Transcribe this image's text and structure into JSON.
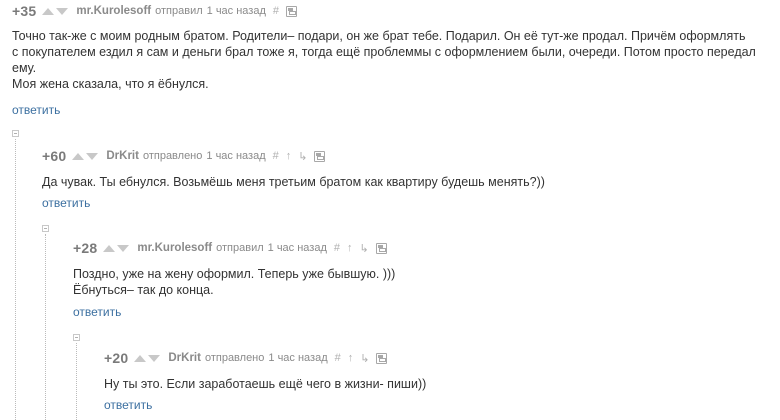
{
  "comments": [
    {
      "rating": "+35",
      "author": "mr.Kurolesoff",
      "action": "отправил",
      "time": "1 час назад",
      "hash_icon": "hash-icon",
      "lines": [
        "Точно так-же с моим родным братом. Родители– подари, он же брат тебе. Подарил. Он её тут-же продал. Причём оформлять",
        "с покупателем ездил я сам и деньги брал тоже я, тогда ещё проблеммы с оформлением были, очереди. Потом просто передал",
        "ему.",
        "Моя жена сказала, что я ёбнулся."
      ],
      "reply": "ответить"
    },
    {
      "rating": "+60",
      "author": "DrKrit",
      "action": "отправлено",
      "time": "1 час назад",
      "lines": [
        "Да чувак. Ты ебнулся. Возьмёшь меня третьим братом как квартиру будешь менять?))"
      ],
      "reply": "ответить"
    },
    {
      "rating": "+28",
      "author": "mr.Kurolesoff",
      "action": "отправил",
      "time": "1 час назад",
      "lines": [
        "Поздно, уже на жену оформил. Теперь уже бывшую. )))",
        "Ёбнуться– так до конца."
      ],
      "reply": "ответить"
    },
    {
      "rating": "+20",
      "author": "DrKrit",
      "action": "отправлено",
      "time": "1 час назад",
      "lines": [
        "Ну ты это. Если заработаешь ещё чего в жизни- пиши))"
      ],
      "reply": "ответить"
    }
  ],
  "icons": {
    "hash": "#",
    "parent": "↑",
    "branch": "↳"
  }
}
